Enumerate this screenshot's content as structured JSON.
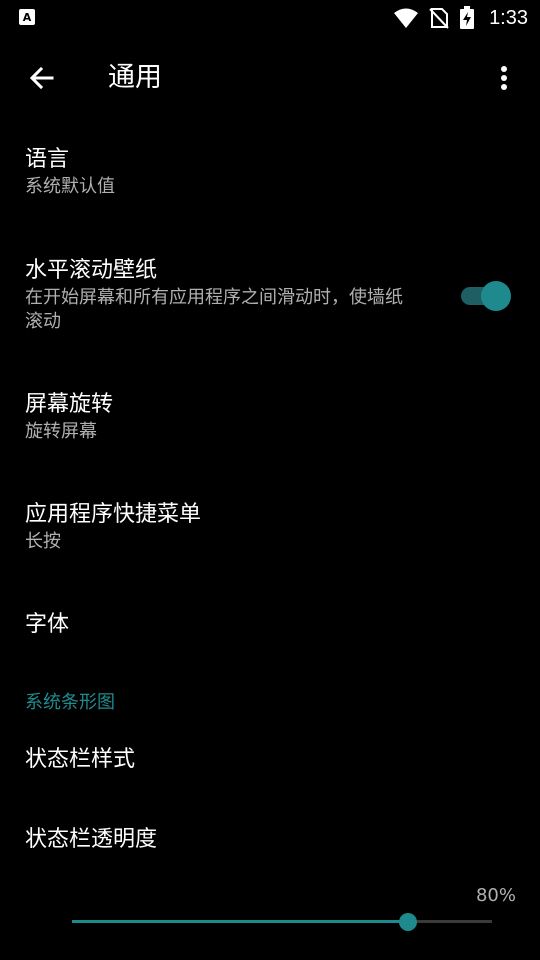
{
  "status_bar": {
    "time": "1:33",
    "icons": [
      "font-app-icon",
      "wifi-icon",
      "no-sim-icon",
      "battery-charging-icon"
    ]
  },
  "toolbar": {
    "back_icon": "arrow-back-icon",
    "title": "通用",
    "overflow_icon": "more-vert-icon"
  },
  "preferences": [
    {
      "id": "language",
      "title": "语言",
      "summary": "系统默认值"
    },
    {
      "id": "wallpaper-scroll",
      "title": "水平滚动壁纸",
      "summary": "在开始屏幕和所有应用程序之间滑动时，使墙纸滚动",
      "switch_on": true
    },
    {
      "id": "screen-rotation",
      "title": "屏幕旋转",
      "summary": "旋转屏幕"
    },
    {
      "id": "app-shortcut-menu",
      "title": "应用程序快捷菜单",
      "summary": "长按"
    },
    {
      "id": "font",
      "title": "字体"
    }
  ],
  "section": {
    "header": "系统条形图",
    "items": [
      {
        "id": "statusbar-style",
        "title": "状态栏样式"
      },
      {
        "id": "statusbar-transparency",
        "title": "状态栏透明度"
      }
    ]
  },
  "transparency_slider": {
    "value_label": "80%",
    "value": 0.8
  },
  "colors": {
    "background": "#000000",
    "accent": "#1e8a8d",
    "accent_dim": "#1d5f62",
    "secondary_text": "#b0b0b0"
  }
}
